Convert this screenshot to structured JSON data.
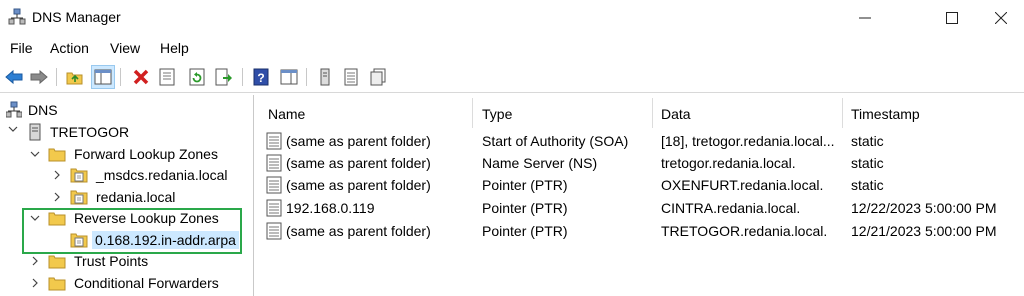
{
  "window": {
    "title": "DNS Manager",
    "controls": {
      "minimize": "—",
      "maximize": "☐",
      "close": "✕"
    }
  },
  "menu": [
    "File",
    "Action",
    "View",
    "Help"
  ],
  "toolbar_icons": [
    "back-icon",
    "forward-icon",
    "up-folder-icon",
    "show-hide-tree-icon",
    "delete-icon",
    "properties-icon",
    "refresh-icon",
    "export-icon",
    "help-icon",
    "action-pane-icon",
    "server-icon",
    "list-icon",
    "copy-icon"
  ],
  "tree": {
    "root": "DNS",
    "server": "TRETOGOR",
    "forward_zones": "Forward Lookup Zones",
    "forward_children": [
      "_msdcs.redania.local",
      "redania.local"
    ],
    "reverse_zones": "Reverse Lookup Zones",
    "reverse_children": [
      "0.168.192.in-addr.arpa"
    ],
    "trust_points": "Trust Points",
    "conditional_forwarders": "Conditional Forwarders"
  },
  "columns": {
    "name": "Name",
    "type": "Type",
    "data": "Data",
    "timestamp": "Timestamp"
  },
  "records": [
    {
      "name": "(same as parent folder)",
      "type": "Start of Authority (SOA)",
      "data": "[18], tretogor.redania.local...",
      "timestamp": "static"
    },
    {
      "name": "(same as parent folder)",
      "type": "Name Server (NS)",
      "data": "tretogor.redania.local.",
      "timestamp": "static"
    },
    {
      "name": "(same as parent folder)",
      "type": "Pointer (PTR)",
      "data": "OXENFURT.redania.local.",
      "timestamp": "static"
    },
    {
      "name": "192.168.0.119",
      "type": "Pointer (PTR)",
      "data": "CINTRA.redania.local.",
      "timestamp": "12/22/2023 5:00:00 PM"
    },
    {
      "name": "(same as parent folder)",
      "type": "Pointer (PTR)",
      "data": "TRETOGOR.redania.local.",
      "timestamp": "12/21/2023 5:00:00 PM"
    }
  ],
  "colors": {
    "highlight_border": "#2aa84a",
    "folder": "#f2c94c",
    "selection": "#cce8ff"
  }
}
